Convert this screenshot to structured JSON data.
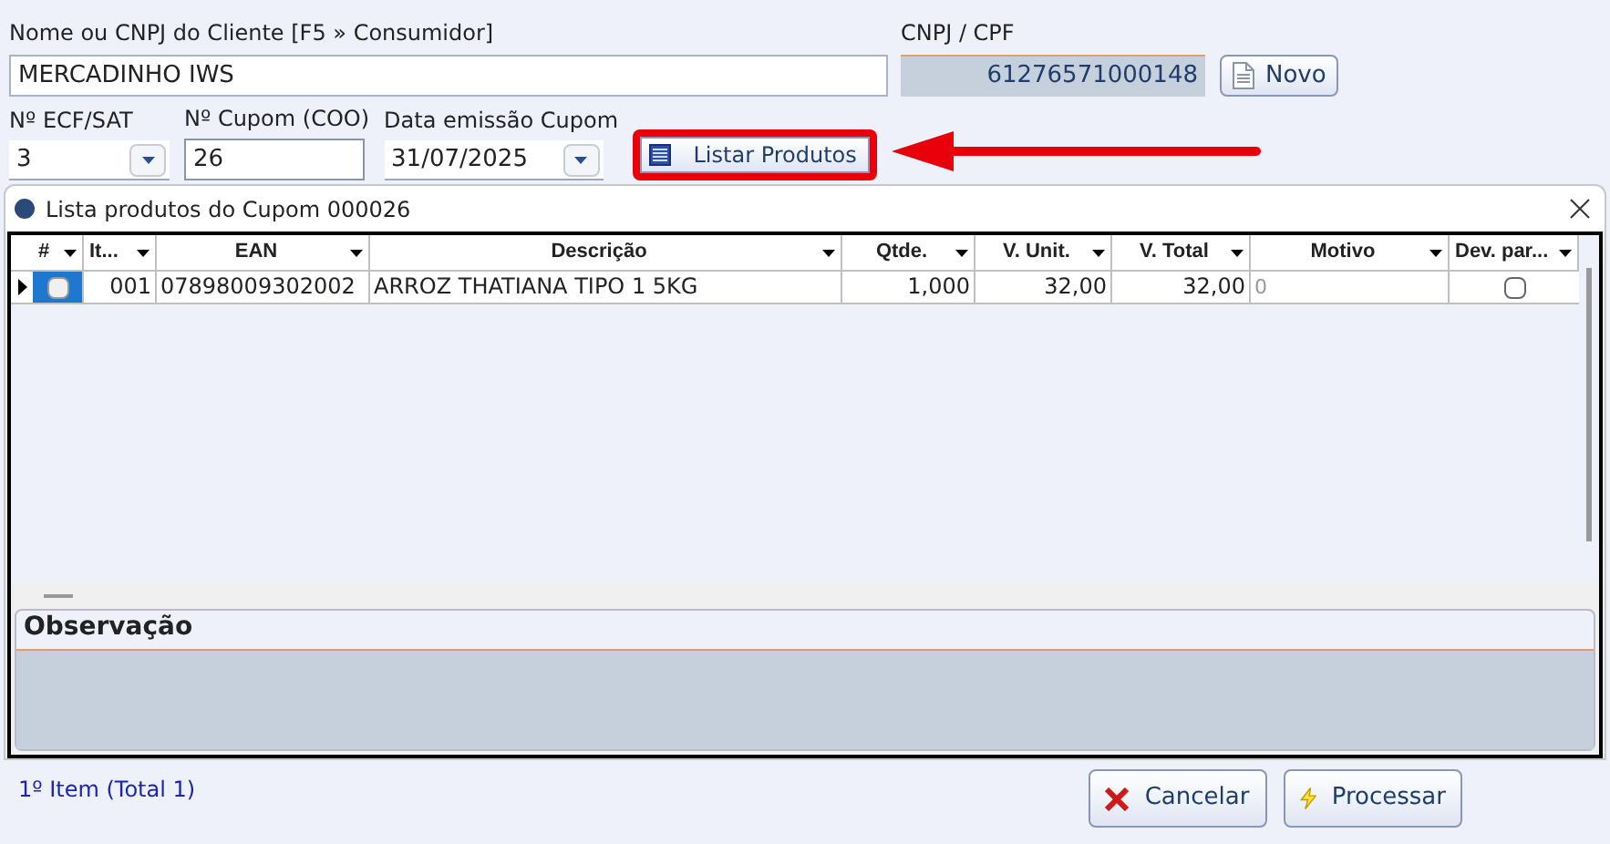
{
  "client": {
    "label": "Nome ou CNPJ do Cliente [F5 » Consumidor]",
    "value": "MERCADINHO IWS"
  },
  "cnpj": {
    "label": "CNPJ / CPF",
    "value": "61276571000148"
  },
  "new_button": {
    "label": "Novo"
  },
  "ecf": {
    "label": "Nº ECF/SAT",
    "value": "3"
  },
  "coupon": {
    "label": "Nº Cupom (COO)",
    "value": "26"
  },
  "date": {
    "label": "Data emissão Cupom",
    "value": "31/07/2025"
  },
  "list_button": {
    "label": "Listar Produtos",
    "highlighted": true
  },
  "dialog": {
    "title": "Lista produtos do Cupom 000026",
    "table": {
      "columns": [
        "#",
        "It...",
        "EAN",
        "Descrição",
        "Qtde.",
        "V. Unit.",
        "V. Total",
        "Motivo",
        "Dev. par..."
      ],
      "rows": [
        {
          "current": true,
          "checked": false,
          "item": "001",
          "ean": "07898009302002",
          "description": "ARROZ THATIANA TIPO 1 5KG",
          "qty": "1,000",
          "unit": "32,00",
          "total": "32,00",
          "reason": "0",
          "partial": false
        }
      ]
    },
    "observation": {
      "label": "Observação"
    }
  },
  "status": "1º Item (Total 1)",
  "buttons": [
    {
      "kind": "cancel",
      "label": "Cancelar"
    },
    {
      "kind": "process",
      "label": "Processar"
    }
  ]
}
